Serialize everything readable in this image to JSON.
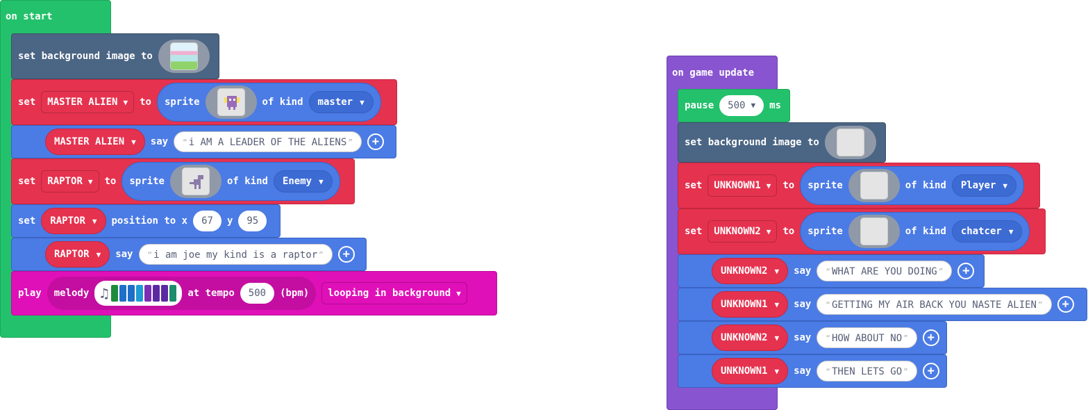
{
  "left": {
    "hat_label": "on start",
    "bg": {
      "label": "set background image to"
    },
    "s1": {
      "set": "set",
      "var": "MASTER ALIEN",
      "to": "to",
      "sprite": "sprite",
      "of_kind": "of kind",
      "kind": "master"
    },
    "s2": {
      "var": "MASTER ALIEN",
      "say": "say",
      "text": "i AM A LEADER OF THE ALIENS"
    },
    "s3": {
      "set": "set",
      "var": "RAPTOR",
      "to": "to",
      "sprite": "sprite",
      "of_kind": "of kind",
      "kind": "Enemy"
    },
    "s4": {
      "set": "set",
      "var": "RAPTOR",
      "position_to_x": "position to x",
      "x": "67",
      "y_label": "y",
      "y": "95"
    },
    "s5": {
      "var": "RAPTOR",
      "say": "say",
      "text": "i am joe my kind is a raptor"
    },
    "s6": {
      "play": "play",
      "melody": "melody",
      "at_tempo": "at tempo",
      "tempo": "500",
      "bpm": "(bpm)",
      "mode": "looping in background",
      "melody_colors": [
        "#1c8c3c",
        "#1d6fc9",
        "#1d6fc9",
        "#1f9bd6",
        "#7b2fb5",
        "#5b2aa3",
        "#5b2aa3",
        "#1c8c6b"
      ]
    }
  },
  "right": {
    "hat_label": "on game update",
    "pause": {
      "label": "pause",
      "value": "500",
      "unit": "ms"
    },
    "bg": {
      "label": "set background image to"
    },
    "s1": {
      "set": "set",
      "var": "UNKNOWN1",
      "to": "to",
      "sprite": "sprite",
      "of_kind": "of kind",
      "kind": "Player"
    },
    "s2": {
      "set": "set",
      "var": "UNKNOWN2",
      "to": "to",
      "sprite": "sprite",
      "of_kind": "of kind",
      "kind": "chatcer"
    },
    "say1": {
      "var": "UNKNOWN2",
      "say": "say",
      "text": "WHAT ARE YOU DOING"
    },
    "say2": {
      "var": "UNKNOWN1",
      "say": "say",
      "text": "GETTING MY AIR BACK YOU NASTE ALIEN"
    },
    "say3": {
      "var": "UNKNOWN2",
      "say": "say",
      "text": "HOW ABOUT NO"
    },
    "say4": {
      "var": "UNKNOWN1",
      "say": "say",
      "text": "THEN LETS GO"
    }
  },
  "icons": {
    "dropdown": "▼",
    "add": "+",
    "music": "♫"
  }
}
